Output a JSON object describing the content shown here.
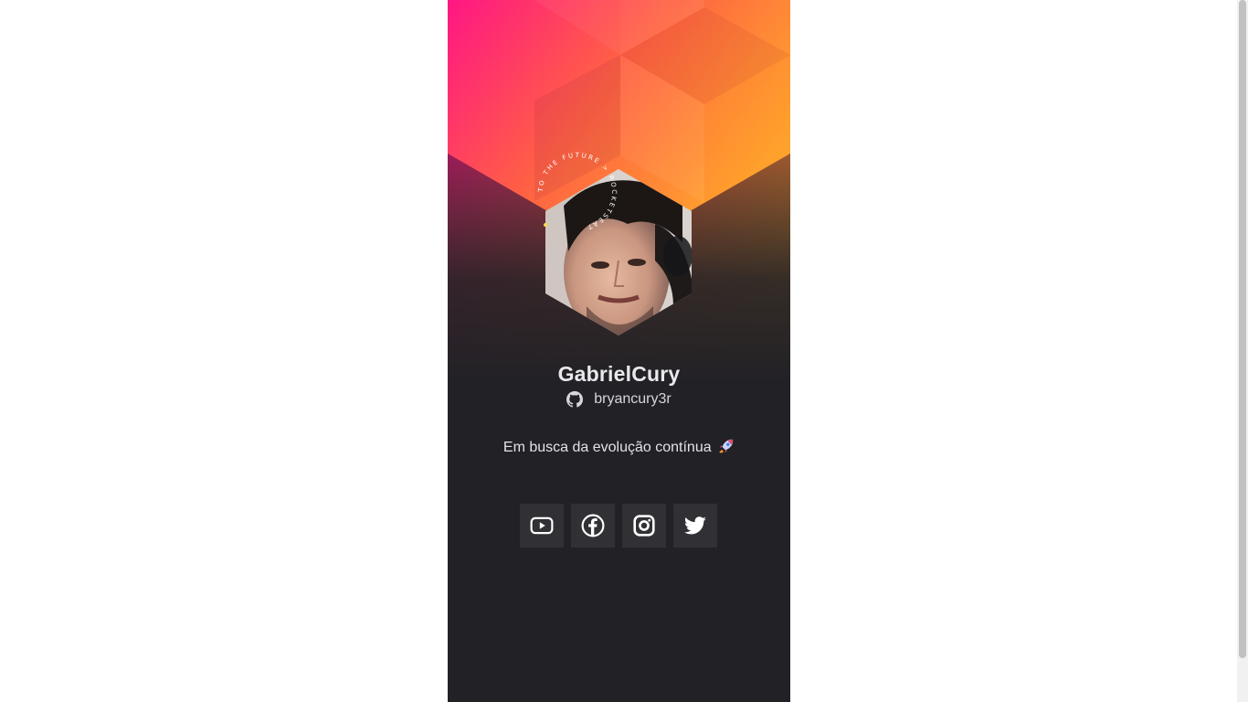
{
  "profile": {
    "name": "GabrielCury",
    "github_handle": "bryancury3r",
    "bio": "Em busca da evolução contínua",
    "bio_emoji": "rocket-icon",
    "badge_text": "TO THE FUTURE > ROCKETSEAT"
  },
  "socials": [
    {
      "name": "youtube",
      "icon": "youtube-icon"
    },
    {
      "name": "facebook",
      "icon": "facebook-icon"
    },
    {
      "name": "instagram",
      "icon": "instagram-icon"
    },
    {
      "name": "twitter",
      "icon": "twitter-icon"
    }
  ],
  "colors": {
    "card_background": "#222126",
    "gradient_start": "#ff1f8e",
    "gradient_mid": "#ff6a3d",
    "gradient_end": "#ffa92a",
    "social_button": "#303035",
    "text": "#e9e9ec"
  }
}
